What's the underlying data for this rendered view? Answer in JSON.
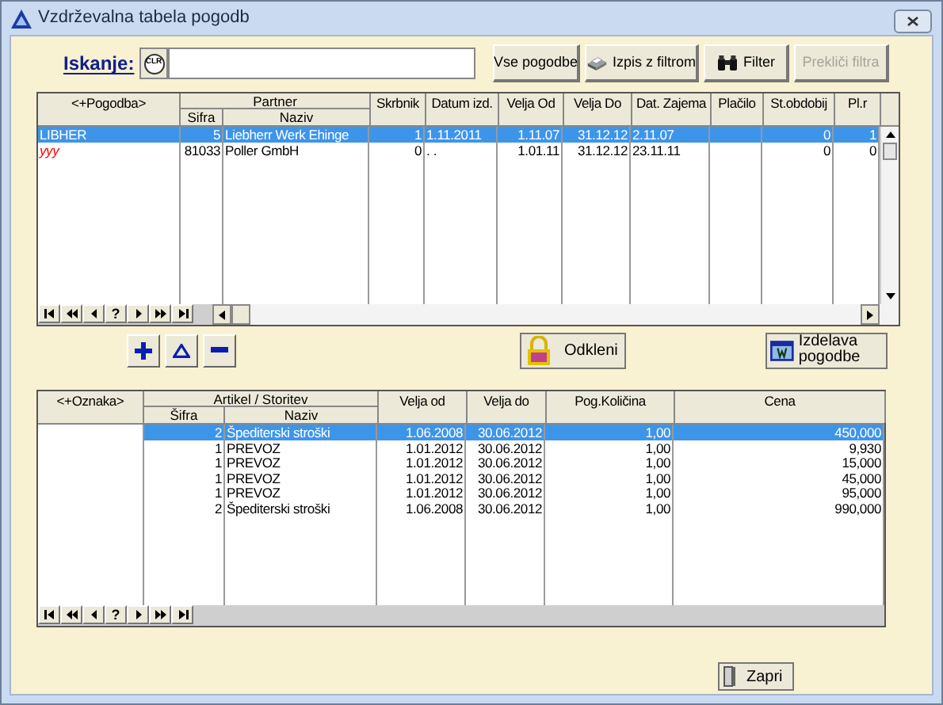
{
  "window": {
    "title": "Vzdrževalna tabela pogodb"
  },
  "search": {
    "label": "Iskanje:",
    "clear_button": "CLR"
  },
  "toolbar": [
    {
      "kind": "plain",
      "label": "Vse pogodbe",
      "disabled": false
    },
    {
      "kind": "print",
      "label": "Izpis z filtrom",
      "disabled": false
    },
    {
      "kind": "filter",
      "label": "Filter",
      "disabled": false
    },
    {
      "kind": "plain",
      "label": "Prekliči filtra",
      "disabled": true
    }
  ],
  "contracts_table": {
    "columns": [
      {
        "label": "<+Pogodba>"
      },
      {
        "label": "Sifra",
        "group_start": "Partner"
      },
      {
        "label": "Naziv",
        "group_member": true
      },
      {
        "label": "Skrbnik"
      },
      {
        "label": "Datum izd."
      },
      {
        "label": "Velja Od"
      },
      {
        "label": "Velja Do"
      },
      {
        "label": "Dat. Zajema"
      },
      {
        "label": "Plačilo"
      },
      {
        "label": "St.obdobij"
      },
      {
        "label": "Pl.r"
      }
    ],
    "rows": [
      {
        "selected": true,
        "marked": false,
        "cells": [
          "LIBHER",
          "5",
          "Liebherr Werk Ehinge",
          "1",
          "1.11.2011",
          "1.11.07",
          "31.12.12",
          "2.11.07",
          null,
          "0",
          "1"
        ]
      },
      {
        "selected": false,
        "marked": true,
        "cells": [
          "yyy",
          "81033",
          "Poller GmbH",
          "0",
          ". .",
          "1.01.11",
          "31.12.12",
          "23.11.11",
          null,
          "0",
          "0"
        ]
      }
    ],
    "navigator": [
      {
        "kind": "first"
      },
      {
        "kind": "page_back"
      },
      {
        "kind": "back"
      },
      {
        "kind": "find",
        "label": "?"
      },
      {
        "kind": "forward"
      },
      {
        "kind": "page_forward"
      },
      {
        "kind": "last"
      }
    ]
  },
  "row_actions": [
    {
      "kind": "add"
    },
    {
      "kind": "edit"
    },
    {
      "kind": "delete"
    }
  ],
  "unlock_button": {
    "label": "Odkleni"
  },
  "create_button": {
    "label": "Izdelava pogodbe"
  },
  "items_table": {
    "columns": [
      {
        "label": "<+Oznaka>"
      },
      {
        "label": "Šifra",
        "group_start": "Artikel / Storitev"
      },
      {
        "label": "Naziv",
        "group_member": true
      },
      {
        "label": "Velja od"
      },
      {
        "label": "Velja do"
      },
      {
        "label": "Pog.Količina"
      },
      {
        "label": "Cena"
      }
    ],
    "rows": [
      {
        "selected": true,
        "cells": [
          null,
          "2",
          "Špediterski stroški",
          "1.06.2008",
          "30.06.2012",
          "1,00",
          "450,000"
        ]
      },
      {
        "selected": false,
        "cells": [
          null,
          "1",
          "PREVOZ",
          "1.01.2012",
          "30.06.2012",
          "1,00",
          "9,930"
        ]
      },
      {
        "selected": false,
        "cells": [
          null,
          "1",
          "PREVOZ",
          "1.01.2012",
          "30.06.2012",
          "1,00",
          "15,000"
        ]
      },
      {
        "selected": false,
        "cells": [
          null,
          "1",
          "PREVOZ",
          "1.01.2012",
          "30.06.2012",
          "1,00",
          "45,000"
        ]
      },
      {
        "selected": false,
        "cells": [
          null,
          "1",
          "PREVOZ",
          "1.01.2012",
          "30.06.2012",
          "1,00",
          "95,000"
        ]
      },
      {
        "selected": false,
        "cells": [
          null,
          "2",
          "Špediterski stroški",
          "1.06.2008",
          "30.06.2012",
          "1,00",
          "990,000"
        ]
      }
    ],
    "navigator": [
      {
        "kind": "first"
      },
      {
        "kind": "page_back"
      },
      {
        "kind": "back"
      },
      {
        "kind": "find",
        "label": "?"
      },
      {
        "kind": "forward"
      },
      {
        "kind": "page_forward"
      },
      {
        "kind": "last"
      }
    ]
  },
  "close_button": {
    "label": "Zapri"
  }
}
